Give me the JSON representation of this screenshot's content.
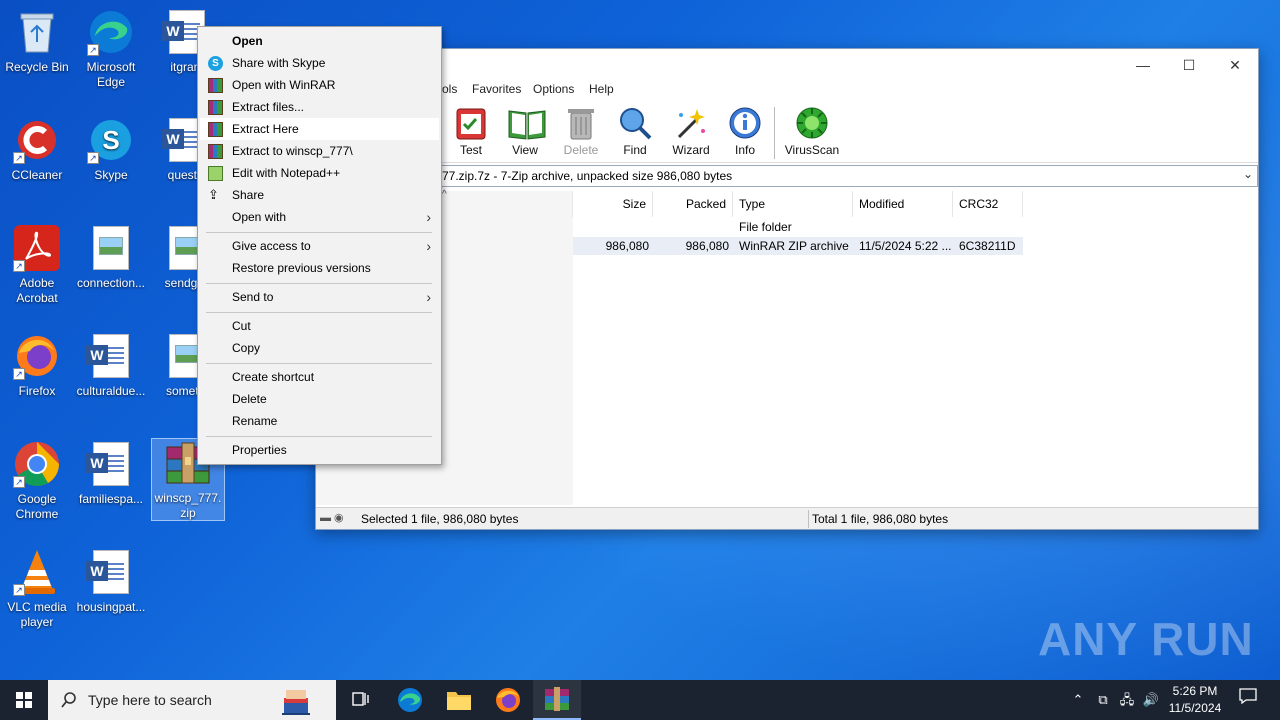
{
  "desktop": {
    "icons": [
      {
        "label": "Recycle Bin"
      },
      {
        "label": "Microsoft Edge"
      },
      {
        "label": "itgrant"
      },
      {
        "label": "CCleaner"
      },
      {
        "label": "Skype"
      },
      {
        "label": "questio"
      },
      {
        "label": "Adobe Acrobat"
      },
      {
        "label": "connection..."
      },
      {
        "label": "sendgall"
      },
      {
        "label": "Firefox"
      },
      {
        "label": "culturaldue..."
      },
      {
        "label": "sometin"
      },
      {
        "label": "Google Chrome"
      },
      {
        "label": "familiespa..."
      },
      {
        "label": "winscp_777.zip"
      },
      {
        "label": "VLC media player"
      },
      {
        "label": "housingpat..."
      }
    ]
  },
  "context_menu": {
    "items": [
      {
        "label": "Open"
      },
      {
        "label": "Share with Skype"
      },
      {
        "label": "Open with WinRAR"
      },
      {
        "label": "Extract files..."
      },
      {
        "label": "Extract Here"
      },
      {
        "label": "Extract to winscp_777\\"
      },
      {
        "label": "Edit with Notepad++"
      },
      {
        "label": "Share"
      },
      {
        "label": "Open with"
      },
      {
        "label": "Give access to"
      },
      {
        "label": "Restore previous versions"
      },
      {
        "label": "Send to"
      },
      {
        "label": "Cut"
      },
      {
        "label": "Copy"
      },
      {
        "label": "Create shortcut"
      },
      {
        "label": "Delete"
      },
      {
        "label": "Rename"
      },
      {
        "label": "Properties"
      }
    ]
  },
  "winrar": {
    "menu": [
      "ols",
      "Favorites",
      "Options",
      "Help"
    ],
    "toolbar": [
      {
        "label": "Test"
      },
      {
        "label": "View"
      },
      {
        "label": "Delete"
      },
      {
        "label": "Find"
      },
      {
        "label": "Wizard"
      },
      {
        "label": "Info"
      },
      {
        "label": "VirusScan"
      }
    ],
    "path": "77.zip.7z - 7-Zip archive, unpacked size 986,080 bytes",
    "columns": [
      "Size",
      "Packed",
      "Type",
      "Modified",
      "CRC32"
    ],
    "rows": [
      {
        "size": "",
        "packed": "",
        "type": "File folder",
        "modified": "",
        "crc": ""
      },
      {
        "size": "986,080",
        "packed": "986,080",
        "type": "WinRAR ZIP archive",
        "modified": "11/5/2024 5:22 ...",
        "crc": "6C38211D"
      }
    ],
    "status_left": "Selected 1 file, 986,080 bytes",
    "status_right": "Total 1 file, 986,080 bytes"
  },
  "taskbar": {
    "search_placeholder": "Type here to search",
    "time": "5:26 PM",
    "date": "11/5/2024"
  },
  "watermark": "ANY RUN"
}
